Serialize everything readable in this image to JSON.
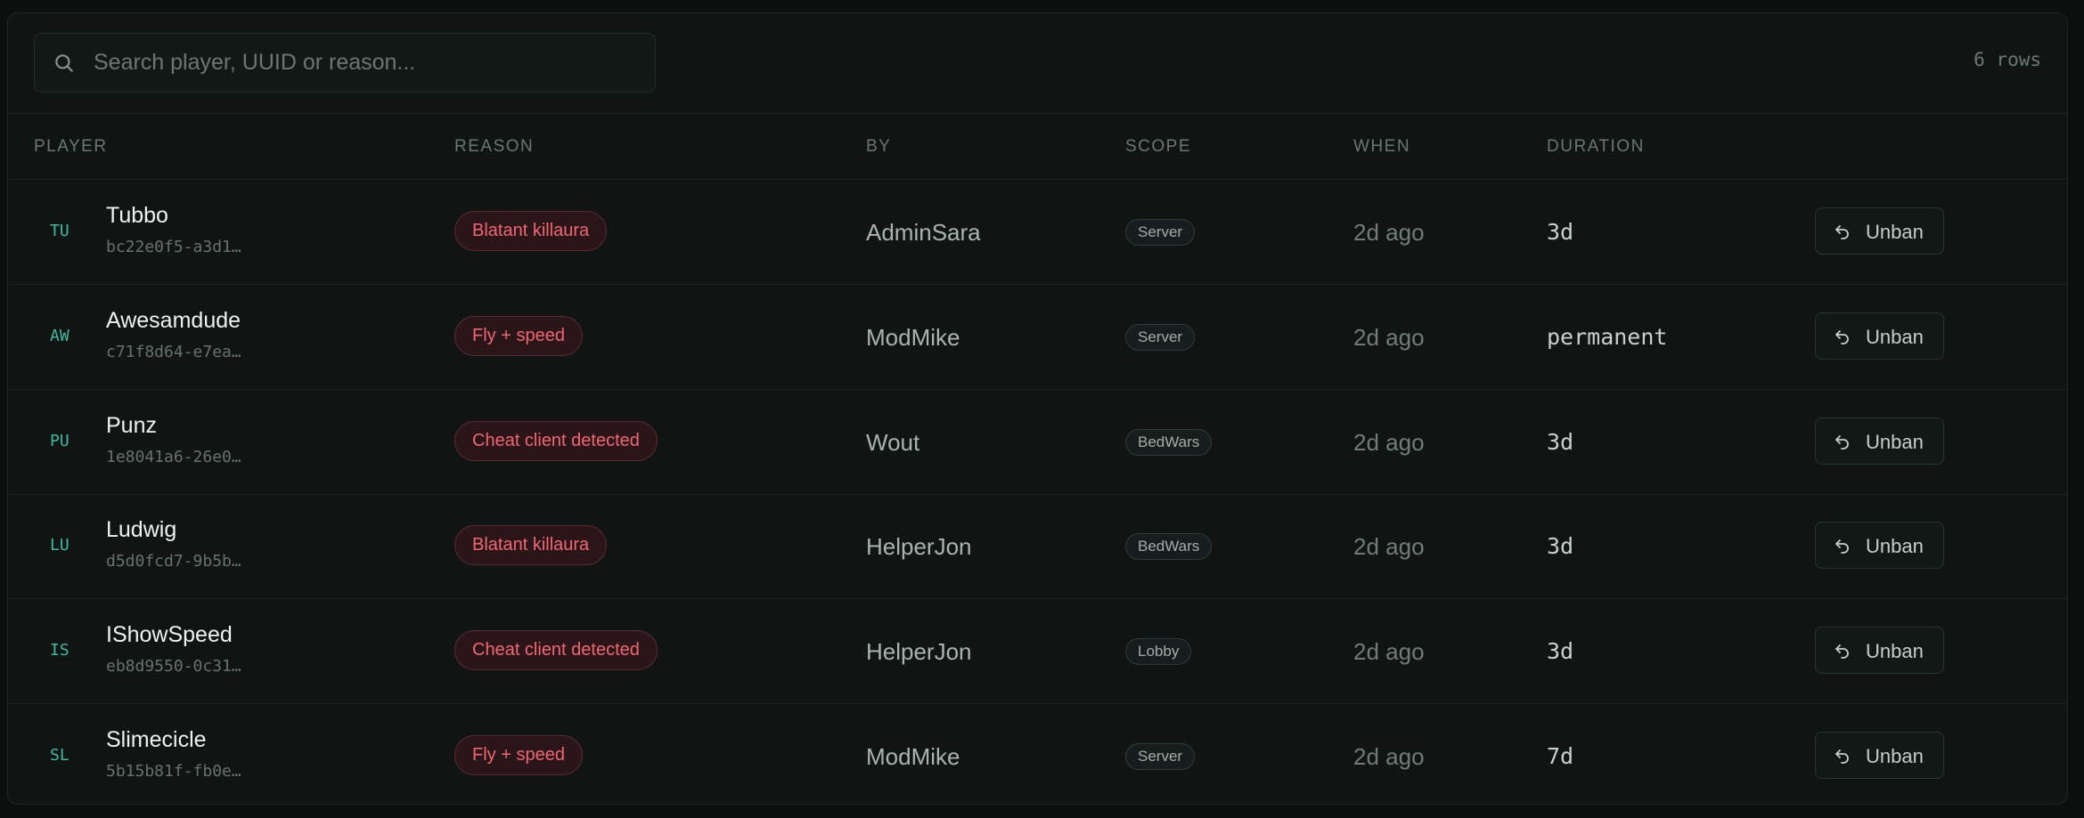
{
  "search": {
    "placeholder": "Search player, UUID or reason..."
  },
  "row_count": "6 rows",
  "columns": {
    "player": "PLAYER",
    "reason": "REASON",
    "by": "BY",
    "scope": "SCOPE",
    "when": "WHEN",
    "duration": "DURATION"
  },
  "icons": {
    "search": "search-icon",
    "unban": "undo-arrow-icon"
  },
  "colors": {
    "accent_initials": "#3fb9a0",
    "reason_text": "#f26673",
    "reason_bg": "#2a1619",
    "background": "#101514"
  },
  "rows": [
    {
      "initials": "TU",
      "name": "Tubbo",
      "uuid": "bc22e0f5-a3d1…",
      "reason": "Blatant killaura",
      "by": "AdminSara",
      "scope": "Server",
      "when": "2d ago",
      "duration": "3d",
      "action": "Unban"
    },
    {
      "initials": "AW",
      "name": "Awesamdude",
      "uuid": "c71f8d64-e7ea…",
      "reason": "Fly + speed",
      "by": "ModMike",
      "scope": "Server",
      "when": "2d ago",
      "duration": "permanent",
      "action": "Unban"
    },
    {
      "initials": "PU",
      "name": "Punz",
      "uuid": "1e8041a6-26e0…",
      "reason": "Cheat client detected",
      "by": "Wout",
      "scope": "BedWars",
      "when": "2d ago",
      "duration": "3d",
      "action": "Unban"
    },
    {
      "initials": "LU",
      "name": "Ludwig",
      "uuid": "d5d0fcd7-9b5b…",
      "reason": "Blatant killaura",
      "by": "HelperJon",
      "scope": "BedWars",
      "when": "2d ago",
      "duration": "3d",
      "action": "Unban"
    },
    {
      "initials": "IS",
      "name": "IShowSpeed",
      "uuid": "eb8d9550-0c31…",
      "reason": "Cheat client detected",
      "by": "HelperJon",
      "scope": "Lobby",
      "when": "2d ago",
      "duration": "3d",
      "action": "Unban"
    },
    {
      "initials": "SL",
      "name": "Slimecicle",
      "uuid": "5b15b81f-fb0e…",
      "reason": "Fly + speed",
      "by": "ModMike",
      "scope": "Server",
      "when": "2d ago",
      "duration": "7d",
      "action": "Unban"
    }
  ]
}
